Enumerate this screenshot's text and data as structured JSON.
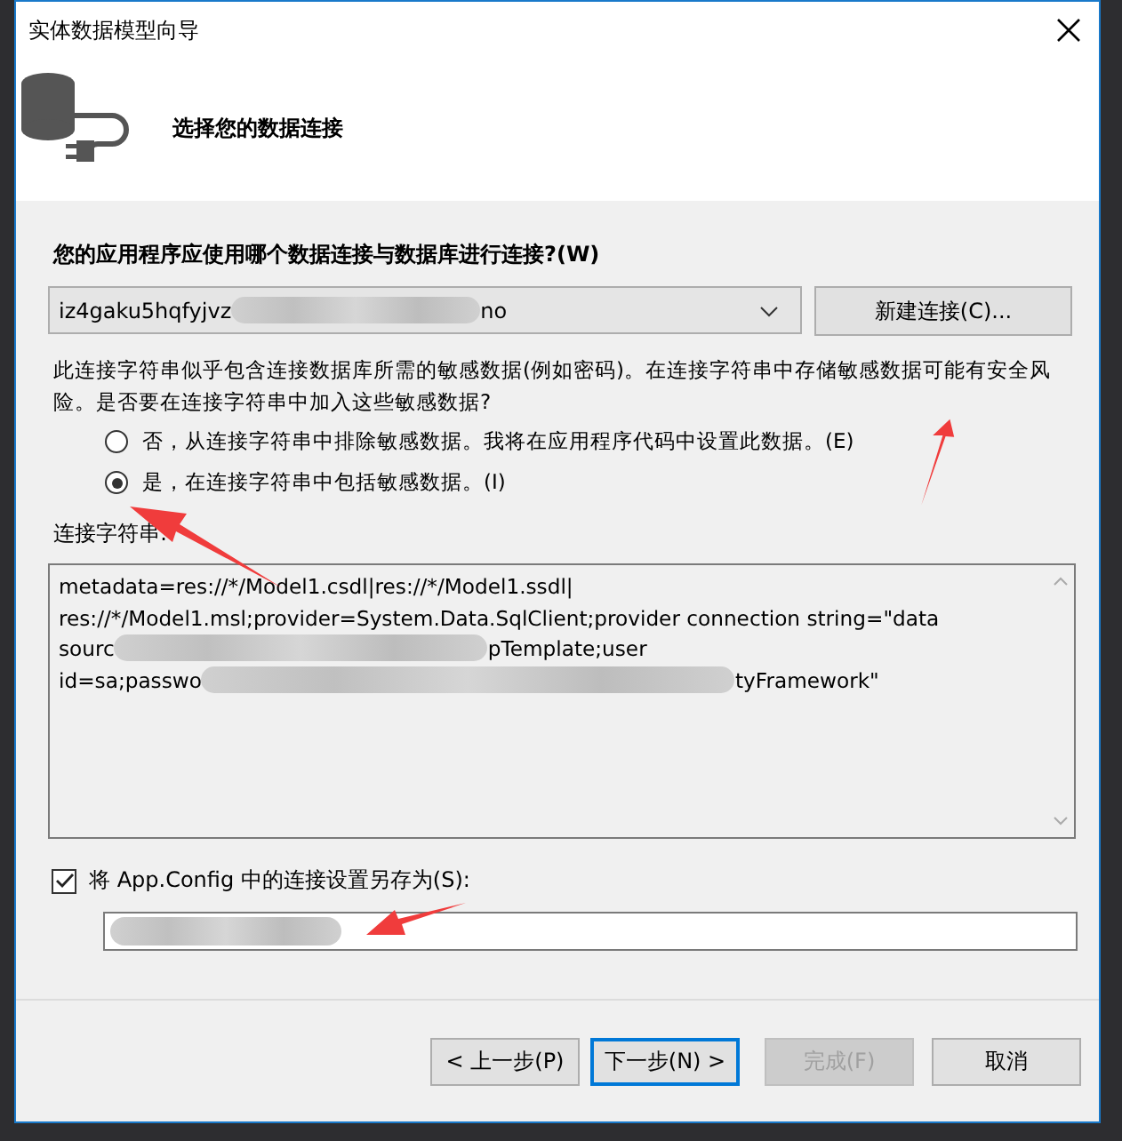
{
  "window": {
    "title": "实体数据模型向导"
  },
  "header": {
    "title": "选择您的数据连接"
  },
  "connection": {
    "label": "您的应用程序应使用哪个数据连接与数据库进行连接?(W)",
    "value_start": "iz4gaku5hqfyjvz",
    "value_end": "no",
    "new_button": "新建连接(C)..."
  },
  "warning": "此连接字符串似乎包含连接数据库所需的敏感数据(例如密码)。在连接字符串中存储敏感数据可能有安全风险。是否要在连接字符串中加入这些敏感数据?",
  "options": [
    {
      "label": "否，从连接字符串中排除敏感数据。我将在应用程序代码中设置此数据。(E)",
      "selected": false
    },
    {
      "label": "是，在连接字符串中包括敏感数据。(I)",
      "selected": true
    }
  ],
  "connection_string": {
    "label": "连接字符串:",
    "lines": [
      {
        "parts": [
          "metadata=res://*/Model1.csdl|res://*/Model1.ssdl|"
        ]
      },
      {
        "parts": [
          "res://*/Model1.msl;provider=System.Data.SqlClient;provider connection string=\"data"
        ]
      },
      {
        "parts": [
          "sourc",
          "pTemplate;user"
        ]
      },
      {
        "parts": [
          "id=sa;passwo",
          "tyFramework\""
        ]
      }
    ]
  },
  "save_config": {
    "label": "将 App.Config 中的连接设置另存为(S):",
    "checked": true
  },
  "buttons": [
    {
      "label": "< 上一步(P)",
      "kind": "normal"
    },
    {
      "label": "下一步(N) >",
      "kind": "default"
    },
    {
      "label": "完成(F)",
      "kind": "disabled"
    },
    {
      "label": "取消",
      "kind": "normal"
    }
  ]
}
